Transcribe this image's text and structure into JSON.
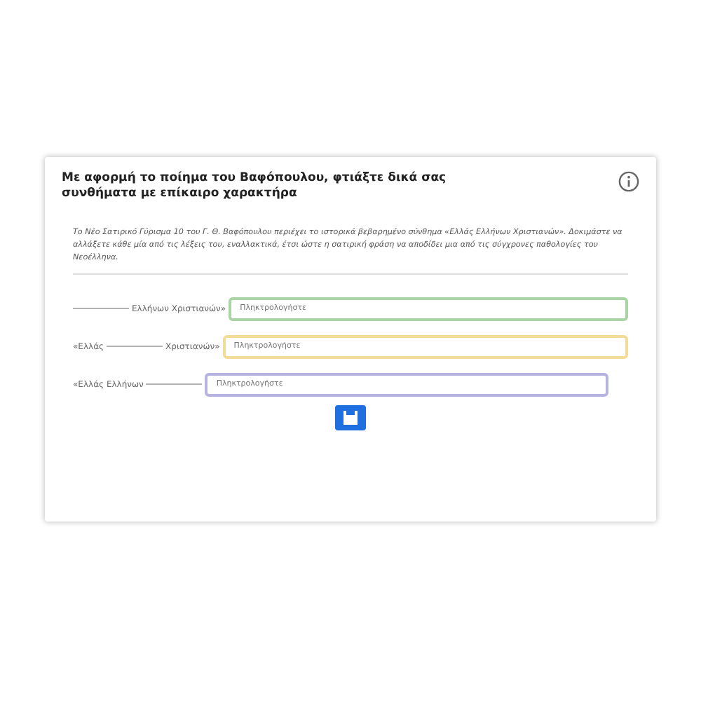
{
  "card": {
    "title": "Με αφορμή το ποίημα του Βαφόπουλου, φτιάξτε δικά σας συνθήματα με επίκαιρο χαρακτήρα",
    "intro": "Το Νέο Σατιρικό Γύρισμα 10 του Γ. Θ. Βαφόπουλου περιέχει το ιστορικά βεβαρημένο σύνθημα «Ελλάς Ελλήνων Χριστιανών». Δοκιμάστε να αλλάξετε κάθε μία από τις λέξεις του, εναλλακτικά, έτσι ώστε η σατιρική φράση να αποδίδει μια από τις σύγχρονες παθολογίες του Νεοέλληνα.",
    "rows": [
      {
        "before": "",
        "after": "Ελλήνων Χριστιανών»",
        "placeholder": "Πληκτρολογήστε",
        "color": "#a9d4a3"
      },
      {
        "before": "«Ελλάς",
        "after": "Χριστιανών»",
        "placeholder": "Πληκτρολογήστε",
        "color": "#f3dc9a"
      },
      {
        "before": "«Ελλάς Ελλήνων",
        "after": "",
        "placeholder": "Πληκτρολογήστε",
        "color": "#b7b3e0"
      }
    ]
  }
}
